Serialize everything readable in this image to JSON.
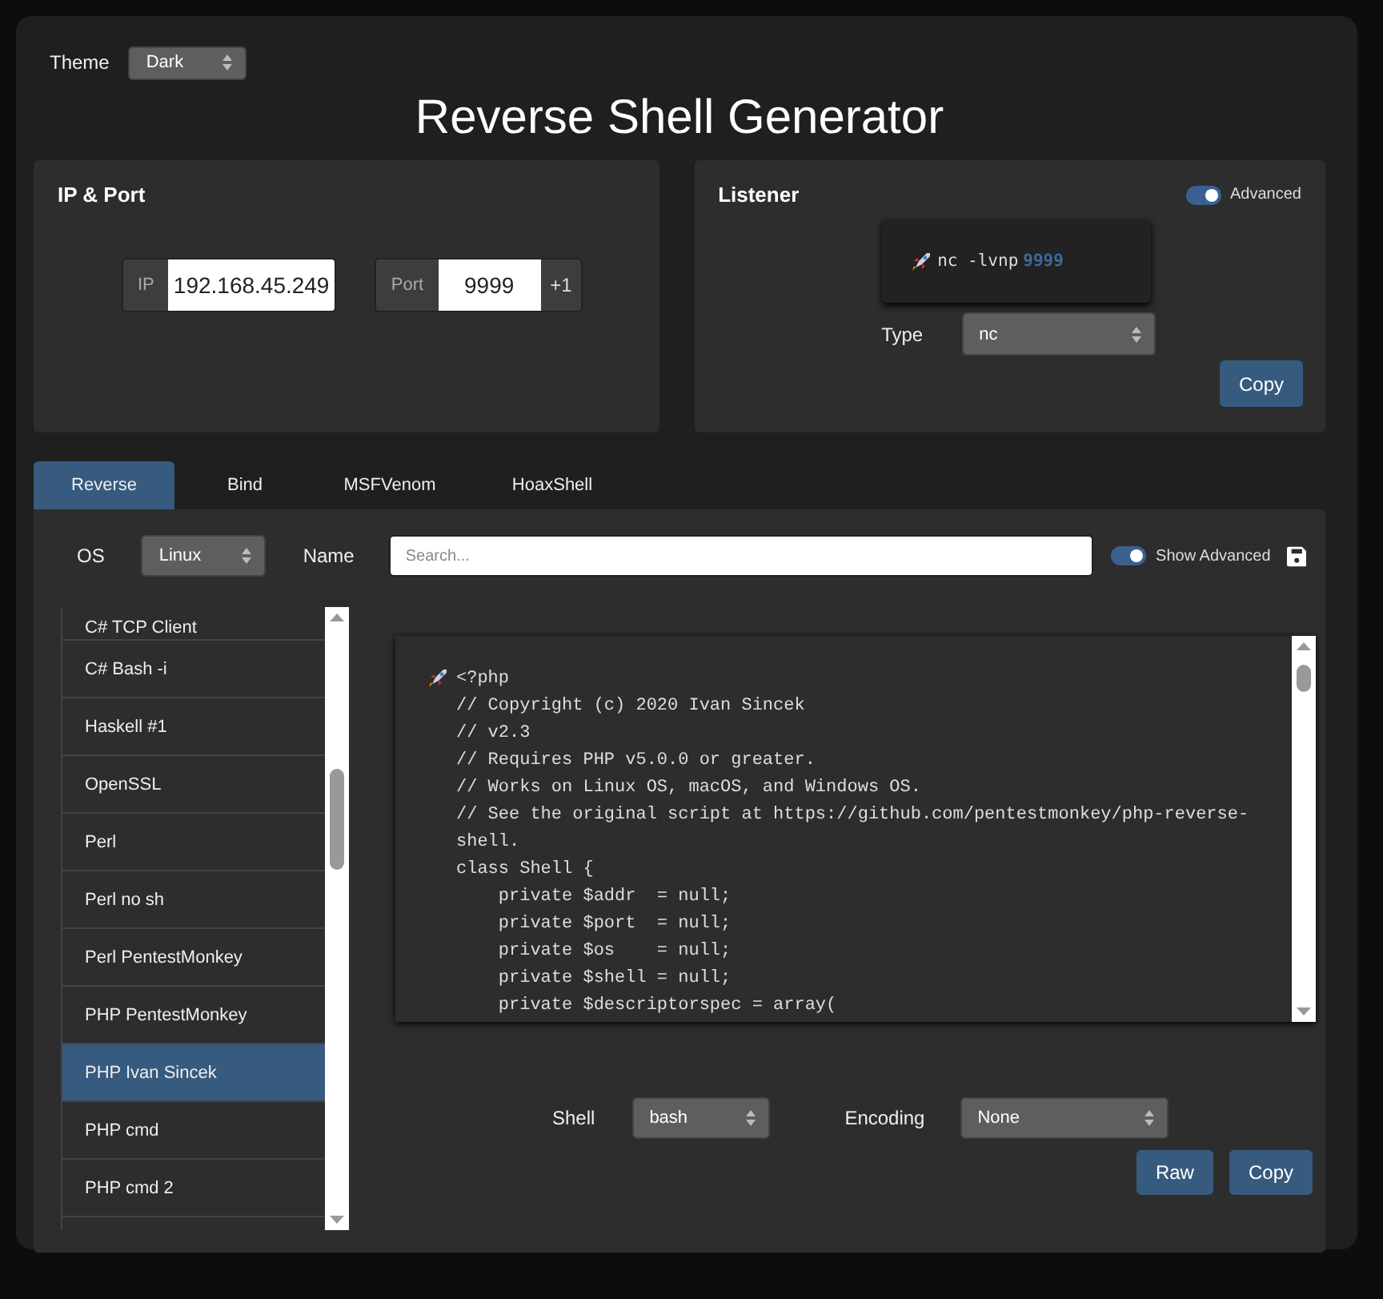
{
  "theme": {
    "label": "Theme",
    "value": "Dark"
  },
  "title": "Reverse Shell Generator",
  "ip_port": {
    "heading": "IP & Port",
    "ip_label": "IP",
    "ip_value": "192.168.45.249",
    "port_label": "Port",
    "port_value": "9999",
    "increment": "+1"
  },
  "listener": {
    "heading": "Listener",
    "advanced": {
      "label": "Advanced",
      "on": true
    },
    "command": "nc -lvnp",
    "command_port": "9999",
    "type_label": "Type",
    "type_value": "nc",
    "copy": "Copy"
  },
  "tabs": [
    {
      "label": "Reverse",
      "selected": true
    },
    {
      "label": "Bind",
      "selected": false
    },
    {
      "label": "MSFVenom",
      "selected": false
    },
    {
      "label": "HoaxShell",
      "selected": false
    }
  ],
  "filters": {
    "os_label": "OS",
    "os_value": "Linux",
    "name_label": "Name",
    "search_placeholder": "Search...",
    "show_advanced": {
      "label": "Show Advanced",
      "on": true
    }
  },
  "shells": [
    {
      "label": "C# TCP Client",
      "selected": false
    },
    {
      "label": "C# Bash -i",
      "selected": false
    },
    {
      "label": "Haskell #1",
      "selected": false
    },
    {
      "label": "OpenSSL",
      "selected": false
    },
    {
      "label": "Perl",
      "selected": false
    },
    {
      "label": "Perl no sh",
      "selected": false
    },
    {
      "label": "Perl PentestMonkey",
      "selected": false
    },
    {
      "label": "PHP PentestMonkey",
      "selected": false
    },
    {
      "label": "PHP Ivan Sincek",
      "selected": true
    },
    {
      "label": "PHP cmd",
      "selected": false
    },
    {
      "label": "PHP cmd 2",
      "selected": false
    }
  ],
  "code": {
    "lines": [
      "<?php",
      "// Copyright (c) 2020 Ivan Sincek",
      "// v2.3",
      "// Requires PHP v5.0.0 or greater.",
      "// Works on Linux OS, macOS, and Windows OS.",
      "// See the original script at https://github.com/pentestmonkey/php-reverse-",
      "shell.",
      "class Shell {",
      "    private $addr  = null;",
      "    private $port  = null;",
      "    private $os    = null;",
      "    private $shell = null;",
      "    private $descriptorspec = array("
    ]
  },
  "options": {
    "shell_label": "Shell",
    "shell_value": "bash",
    "encoding_label": "Encoding",
    "encoding_value": "None"
  },
  "buttons": [
    "Raw",
    "Copy"
  ]
}
